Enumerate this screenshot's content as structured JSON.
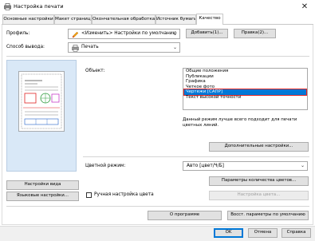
{
  "window": {
    "title": "Настройка печати",
    "close_glyph": "✕"
  },
  "tabs": [
    {
      "label": "Основные настройки"
    },
    {
      "label": "Макет страницы"
    },
    {
      "label": "Окончательная обработка"
    },
    {
      "label": "Источник бумаги"
    },
    {
      "label": "Качество",
      "active": true
    }
  ],
  "profile": {
    "label": "Профиль:",
    "value": "<Изменить> Настройки по умолчанию",
    "add_label": "Добавить(1)...",
    "edit_label": "Правка(2)..."
  },
  "output": {
    "label": "Способ вывода:",
    "value": "Печать"
  },
  "object": {
    "label": "Объект:",
    "items": [
      "Общие положения",
      "Публикации",
      "Графика",
      "Четкое фото",
      "Чертежи [САПР]",
      "Текст высокой точности"
    ],
    "selected_index": 4,
    "description": "Данный режим лучше всего подходит для печати цветных линий.",
    "advanced_label": "Дополнительные настройки..."
  },
  "color": {
    "label": "Цветной режим:",
    "value": "Авто [цвет/Ч/Б]",
    "count_params_label": "Параметры количества цветов...",
    "color_settings_label": "Настройка цвета..."
  },
  "left": {
    "view_settings_label": "Настройки вида",
    "language_settings_label": "Языковые настройки...",
    "manual_color_label": "Ручная настройка цвета",
    "manual_color_checked": false
  },
  "bottom": {
    "about_label": "О программе",
    "restore_label": "Восст. параметры по умолчанию"
  },
  "footer": {
    "ok_label": "OK",
    "cancel_label": "Отмена",
    "help_label": "Справка"
  },
  "colors": {
    "accent": "#0078d7",
    "selection_outline": "#e02424",
    "preview_bg": "#d9e8f7"
  },
  "icons": [
    "printer-app-icon",
    "close-icon",
    "edit-pencil-icon",
    "printer-icon",
    "chevron-down-icon",
    "document-preview-icon"
  ]
}
